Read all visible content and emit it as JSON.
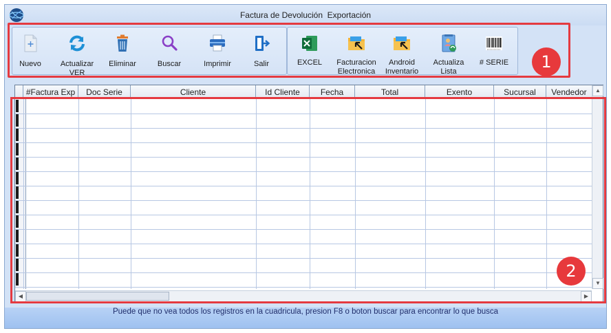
{
  "window": {
    "title": "Factura de Devolución  Exportación"
  },
  "toolbar": {
    "group_main": [
      {
        "label": "Nuevo",
        "icon": "new-document-icon"
      },
      {
        "label": "Actualizar\nVER",
        "icon": "refresh-icon"
      },
      {
        "label": "Eliminar",
        "icon": "trash-icon"
      },
      {
        "label": "Buscar",
        "icon": "search-icon"
      },
      {
        "label": "Imprimir",
        "icon": "printer-icon"
      },
      {
        "label": "Salir",
        "icon": "exit-icon"
      }
    ],
    "group_extra": [
      {
        "label": "EXCEL",
        "icon": "excel-icon"
      },
      {
        "label": "Facturacion\nElectronica",
        "icon": "folder-arrow-icon"
      },
      {
        "label": "Android\nInventario",
        "icon": "folder-arrow-icon"
      },
      {
        "label": "Actualiza\nLista",
        "icon": "list-update-icon"
      },
      {
        "label": "# SERIE",
        "icon": "barcode-icon"
      }
    ]
  },
  "badges": {
    "toolbar": "1",
    "grid": "2"
  },
  "grid": {
    "columns": [
      "#Factura Exp",
      "Doc Serie",
      "Cliente",
      "Id Cliente",
      "Fecha",
      "Total",
      "Exento",
      "Sucursal",
      "Vendedor"
    ],
    "rows": []
  },
  "status": {
    "hint": "Puede que no vea todos los registros en la cuadricula, presion F8 o boton buscar para encontrar lo que busca"
  },
  "colors": {
    "accent_red": "#e53a40",
    "window_bg": "#d3e2f6",
    "bottom_band": "#9ec1f0",
    "status_text": "#1f2d6b"
  }
}
